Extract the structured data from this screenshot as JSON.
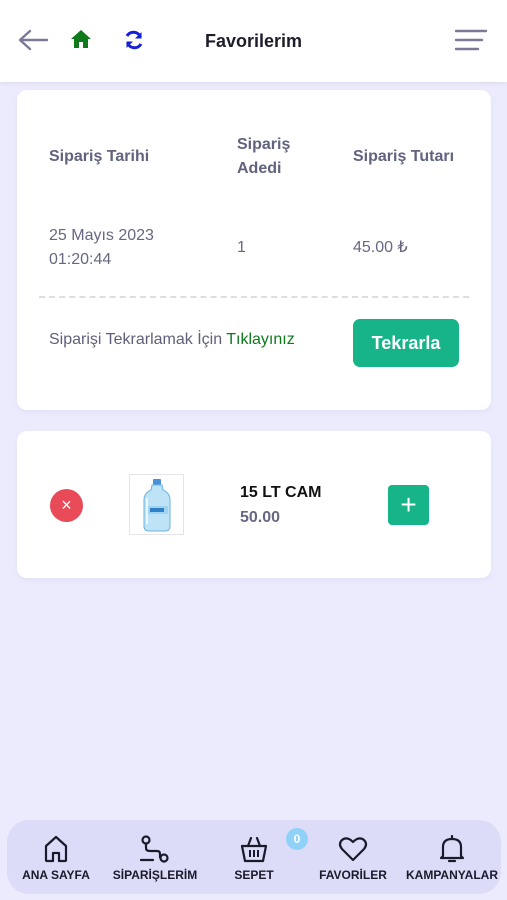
{
  "header": {
    "title": "Favorilerim"
  },
  "order": {
    "date_header": "Sipariş Tarihi",
    "count_header_line1": "Sipariş",
    "count_header_line2": "Adedi",
    "total_header": "Sipariş Tutarı",
    "date": "25 Mayıs 2023",
    "time": "01:20:44",
    "count": "1",
    "total": "45.00 ₺",
    "repeat_prefix": "Siparişi Tekrarlamak İçin",
    "repeat_link": "Tıklayınız",
    "repeat_button": "Tekrarla"
  },
  "product": {
    "remove_symbol": "×",
    "name": "15 LT CAM",
    "price": "50.00",
    "add_symbol": "+"
  },
  "bottom_nav": {
    "items": [
      {
        "label": "ANA SAYFA",
        "icon": "home-icon"
      },
      {
        "label": "SİPARİŞLERİM",
        "icon": "route-icon"
      },
      {
        "label": "SEPET",
        "icon": "basket-icon"
      },
      {
        "label": "FAVORİLER",
        "icon": "heart-icon"
      },
      {
        "label": "KAMPANYALAR",
        "icon": "bell-icon"
      }
    ],
    "cart_count": "0"
  },
  "colors": {
    "accent": "#17b48a",
    "home_icon": "#0e7a1c",
    "refresh_icon": "#1520d8",
    "danger": "#e84a57",
    "background": "#ecebfe"
  }
}
